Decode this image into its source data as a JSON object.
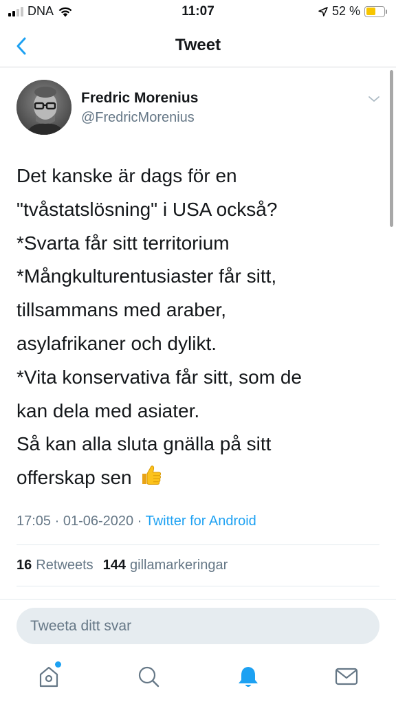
{
  "status_bar": {
    "carrier": "DNA",
    "time": "11:07",
    "battery": "52 %",
    "battery_fraction": 0.52,
    "battery_color": "#f7c500",
    "icons": [
      "signal-icon",
      "wifi-icon",
      "location-arrow-icon",
      "battery-icon"
    ]
  },
  "nav": {
    "title": "Tweet",
    "back_icon": "chevron-left-icon"
  },
  "tweet": {
    "author_name": "Fredric Morenius",
    "author_handle": "@FredricMorenius",
    "text": "Det kanske är dags för en\n\"tvåstatslösning\" i USA också?\n*Svarta får sitt territorium\n*Mångkulturentusiaster får sitt,\ntillsammans med araber,\nasylafrikaner och dylikt.\n*Vita konservativa får sitt, som de\nkan dela med asiater.\nSå kan alla sluta gnälla på sitt\nofferskap sen",
    "emoji_icon": "thumbs-up-icon",
    "time": "17:05",
    "date": "01-06-2020",
    "separator": "·",
    "source": "Twitter for Android",
    "retweets_count": "16",
    "retweets_label": "Retweets",
    "likes_count": "144",
    "likes_label": "gillamarkeringar"
  },
  "reply": {
    "placeholder": "Tweeta ditt svar"
  },
  "tab_bar": {
    "items": [
      "home-icon",
      "search-icon",
      "notifications-icon",
      "messages-icon"
    ],
    "active": "notifications-icon"
  },
  "colors": {
    "accent": "#1da1f2",
    "text": "#14171a",
    "muted": "#657786",
    "reply_bg": "#e6ecf0"
  }
}
